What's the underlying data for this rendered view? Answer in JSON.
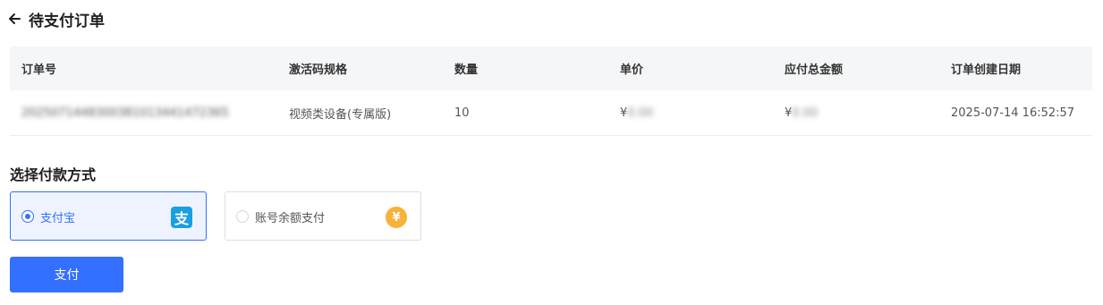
{
  "header": {
    "back_icon": "arrow-left-icon",
    "title": "待支付订单"
  },
  "table": {
    "columns": [
      "订单号",
      "激活码规格",
      "数量",
      "单价",
      "应付总金额",
      "订单创建日期"
    ],
    "rows": [
      {
        "order_no": "2025071448300381013441472365",
        "spec": "视频类设备(专属版)",
        "quantity": "10",
        "unit_price_symbol": "¥",
        "unit_price": "0.00",
        "total_symbol": "¥",
        "total": "0.00",
        "created_at": "2025-07-14 16:52:57"
      }
    ]
  },
  "payment": {
    "section_title": "选择付款方式",
    "options": [
      {
        "label": "支付宝",
        "selected": true,
        "icon": "alipay-icon"
      },
      {
        "label": "账号余额支付",
        "selected": false,
        "icon": "yuan-coin-icon"
      }
    ],
    "alipay_glyph": "支",
    "coin_glyph": "¥",
    "submit_label": "支付"
  },
  "colors": {
    "accent": "#3370ff",
    "header_bg": "#f5f6f8",
    "alipay_blue": "#1a9fe0",
    "coin_orange": "#f7b23b"
  }
}
